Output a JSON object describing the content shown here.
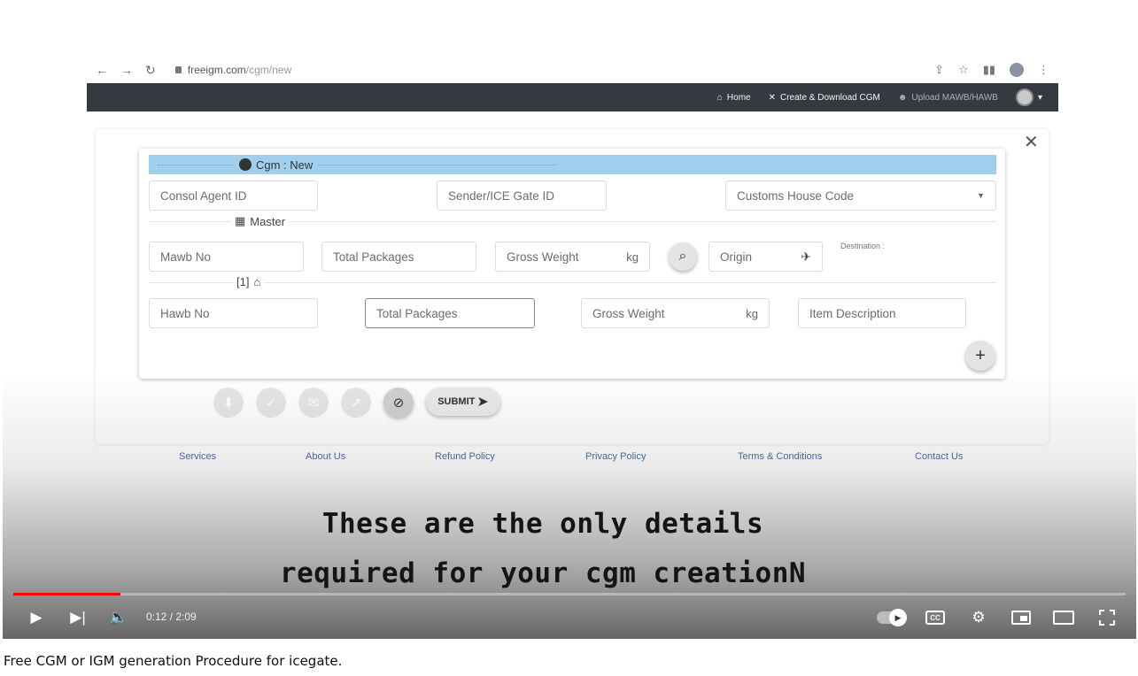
{
  "browser": {
    "url_host": "freeigm.com",
    "url_path": "/cgm/new"
  },
  "navbar": {
    "home": "Home",
    "create": "Create & Download CGM",
    "upload": "Upload MAWB/HAWB"
  },
  "form": {
    "title": "Cgm : New",
    "consol_agent_placeholder": "Consol Agent ID",
    "sender_placeholder": "Sender/ICE Gate ID",
    "customs_house_placeholder": "Customs House Code",
    "master_label": "Master",
    "mawb_placeholder": "Mawb No",
    "master_total_packages": "Total Packages",
    "master_gross_weight": "Gross Weight",
    "kg_unit": "kg",
    "origin_placeholder": "Origin",
    "destination_label": "Destination :",
    "house_index": "[1]",
    "hawb_placeholder": "Hawb No",
    "house_total_packages": "Total Packages",
    "house_gross_weight": "Gross Weight",
    "item_description": "Item Description",
    "submit_label": "SUBMIT"
  },
  "footer": {
    "services": "Services",
    "about": "About Us",
    "refund": "Refund Policy",
    "privacy": "Privacy Policy",
    "terms": "Terms & Conditions",
    "contact": "Contact Us"
  },
  "subtitles": {
    "line1": "These are the only details",
    "line2": "required for your cgm creationN"
  },
  "player": {
    "time": "0:12 / 2:09",
    "progress_fraction": 0.096,
    "progress_color": "#ff0000"
  },
  "video_title": "Free CGM or IGM generation Procedure for icegate."
}
